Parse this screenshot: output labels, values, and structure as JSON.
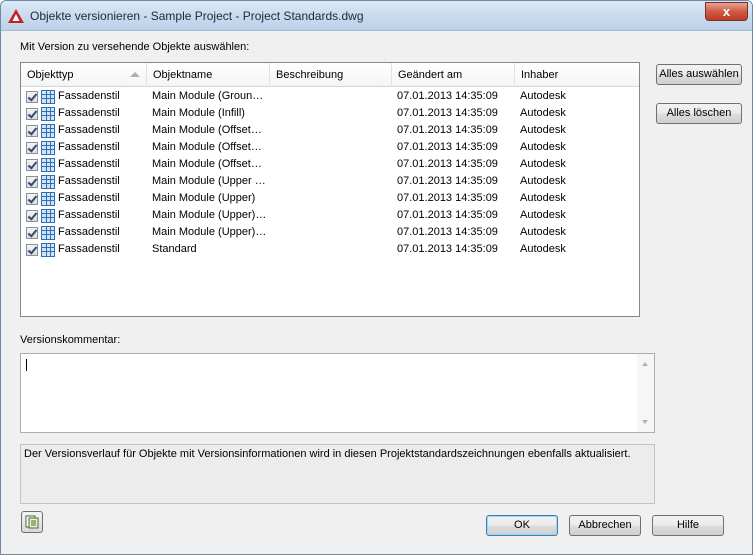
{
  "window": {
    "title": "Objekte versionieren - Sample Project - Project Standards.dwg",
    "close_label": "x"
  },
  "labels": {
    "select_objects": "Mit Version zu versehende Objekte auswählen:",
    "version_comment": "Versionskommentar:",
    "info": "Der Versionsverlauf für Objekte mit Versionsinformationen wird in diesen Projektstandardszeichnungen ebenfalls aktualisiert."
  },
  "table": {
    "columns": [
      "Objekttyp",
      "Objektname",
      "Beschreibung",
      "Geändert am",
      "Inhaber"
    ],
    "rows": [
      {
        "type": "Fassadenstil",
        "name": "Main Module (Groun…",
        "description": "",
        "changed": "07.01.2013 14:35:09",
        "owner": "Autodesk",
        "checked": true
      },
      {
        "type": "Fassadenstil",
        "name": "Main Module (Infill)",
        "description": "",
        "changed": "07.01.2013 14:35:09",
        "owner": "Autodesk",
        "checked": true
      },
      {
        "type": "Fassadenstil",
        "name": "Main Module (Offset…",
        "description": "",
        "changed": "07.01.2013 14:35:09",
        "owner": "Autodesk",
        "checked": true
      },
      {
        "type": "Fassadenstil",
        "name": "Main Module (Offset…",
        "description": "",
        "changed": "07.01.2013 14:35:09",
        "owner": "Autodesk",
        "checked": true
      },
      {
        "type": "Fassadenstil",
        "name": "Main Module (Offset…",
        "description": "",
        "changed": "07.01.2013 14:35:09",
        "owner": "Autodesk",
        "checked": true
      },
      {
        "type": "Fassadenstil",
        "name": "Main Module (Upper …",
        "description": "",
        "changed": "07.01.2013 14:35:09",
        "owner": "Autodesk",
        "checked": true
      },
      {
        "type": "Fassadenstil",
        "name": "Main Module (Upper)",
        "description": "",
        "changed": "07.01.2013 14:35:09",
        "owner": "Autodesk",
        "checked": true
      },
      {
        "type": "Fassadenstil",
        "name": "Main Module (Upper)…",
        "description": "",
        "changed": "07.01.2013 14:35:09",
        "owner": "Autodesk",
        "checked": true
      },
      {
        "type": "Fassadenstil",
        "name": "Main Module (Upper)…",
        "description": "",
        "changed": "07.01.2013 14:35:09",
        "owner": "Autodesk",
        "checked": true
      },
      {
        "type": "Fassadenstil",
        "name": "Standard",
        "description": "",
        "changed": "07.01.2013 14:35:09",
        "owner": "Autodesk",
        "checked": true
      }
    ]
  },
  "buttons": {
    "select_all": "Alles auswählen",
    "clear_all": "Alles löschen",
    "ok": "OK",
    "cancel": "Abbrechen",
    "help": "Hilfe"
  },
  "comment": {
    "value": ""
  },
  "icons": {
    "app": "autocad-logo-icon",
    "row_type": "curtain-wall-style-icon",
    "bottom_left": "compare-icon"
  },
  "colors": {
    "title_bg": "#c7d9ee",
    "close_button": "#c9452f",
    "default_button_border": "#3c7fb1"
  }
}
